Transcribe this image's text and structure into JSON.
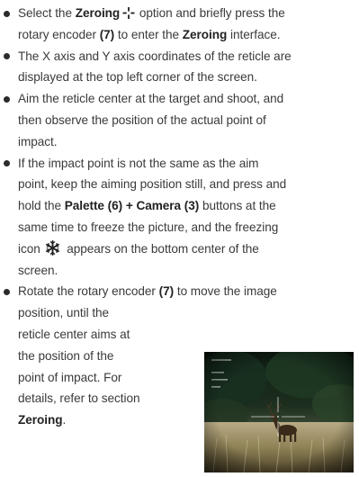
{
  "items": [
    {
      "lines": [
        [
          "Select the ",
          {
            "b": "Zeroing"
          },
          {
            "icon": "zeroing"
          },
          " option and briefly press the"
        ],
        [
          "rotary encoder ",
          {
            "b": "(7)"
          },
          " to enter the ",
          {
            "b": "Zeroing"
          },
          " interface."
        ]
      ]
    },
    {
      "lines": [
        [
          "The X axis and Y axis coordinates of the reticle are"
        ],
        [
          "displayed at the top left corner of the screen."
        ]
      ]
    },
    {
      "lines": [
        [
          "Aim the reticle center at the target and shoot, and"
        ],
        [
          "then observe the position of the actual point of"
        ],
        [
          "impact."
        ]
      ]
    },
    {
      "lines": [
        [
          "If the impact point is not the same as the aim"
        ],
        [
          "point, keep the aiming position still, and press and"
        ],
        [
          "hold the ",
          {
            "b": "Palette (6) + Camera (3)"
          },
          " buttons at the"
        ],
        [
          "same time to freeze the picture, and the freezing"
        ],
        [
          "icon ",
          {
            "icon": "freeze"
          },
          " appears on the bottom center of the"
        ],
        [
          "screen."
        ]
      ]
    },
    {
      "lines": [
        [
          "Rotate the rotary encoder ",
          {
            "b": "(7)"
          },
          " to move the image"
        ],
        [
          "position, until the"
        ],
        [
          "reticle center aims at"
        ],
        [
          "the position of the"
        ],
        [
          "point of impact. For"
        ],
        [
          "details, refer to section"
        ],
        [
          {
            "b": "Zeroing"
          },
          "."
        ]
      ]
    }
  ],
  "colors": {
    "text": "#3a3a3a",
    "bold": "#222222",
    "bullet": "#2b2b2b"
  }
}
